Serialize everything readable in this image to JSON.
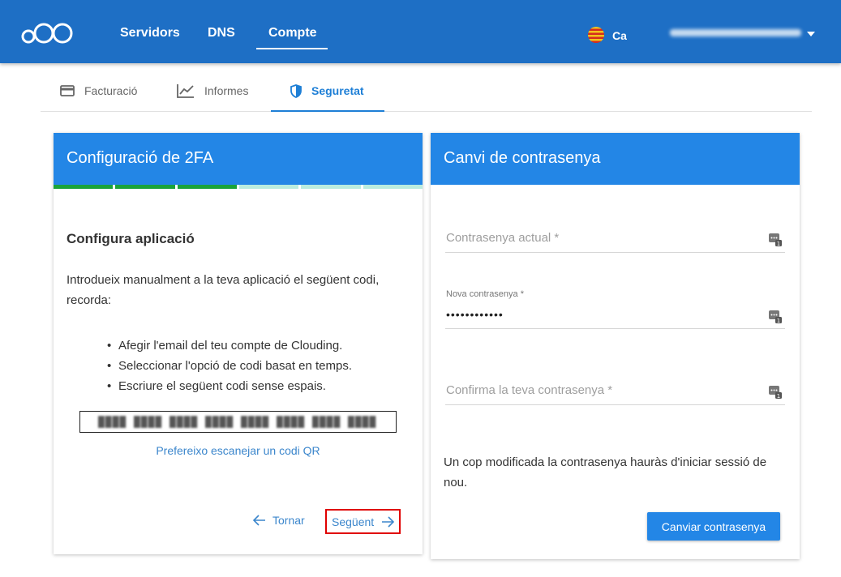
{
  "topnav": {
    "items": [
      {
        "label": "Servidors"
      },
      {
        "label": "DNS"
      },
      {
        "label": "Compte"
      }
    ],
    "language": "Ca"
  },
  "subtabs": [
    {
      "label": "Facturació",
      "icon": "credit-card-icon"
    },
    {
      "label": "Informes",
      "icon": "chart-line-icon"
    },
    {
      "label": "Seguretat",
      "icon": "shield-icon"
    }
  ],
  "twofa": {
    "title": "Configuració de 2FA",
    "progress": {
      "total_steps": 6,
      "completed_steps": 3
    },
    "step_title": "Configura aplicació",
    "intro": "Introdueix manualment a la teva aplicació el següent codi, recorda:",
    "bullets": [
      "Afegir l'email del teu compte de Clouding.",
      "Seleccionar l'opció de codi basat en temps.",
      "Escriure el següent codi sense espais."
    ],
    "qr_link": "Prefereixo escanejar un codi QR",
    "back_label": "Tornar",
    "next_label": "Següent"
  },
  "password": {
    "title": "Canvi de contrasenya",
    "current_placeholder": "Contrasenya actual *",
    "new_label": "Nova contrasenya *",
    "new_value": "••••••••••••",
    "confirm_placeholder": "Confirma la teva contrasenya *",
    "note": "Un cop modificada la contrasenya hauràs d'iniciar sessió de nou.",
    "submit_label": "Canviar contrasenya"
  },
  "colors": {
    "brand": "#1e6fc5",
    "accent": "#2386e6",
    "progress_done": "#1aa33a",
    "progress_todo": "#b9ecdf",
    "highlight": "#e00000"
  }
}
